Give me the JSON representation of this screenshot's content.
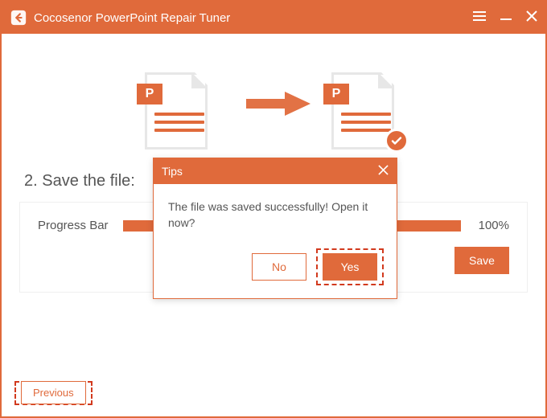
{
  "colors": {
    "accent": "#e06a3b",
    "highlight_dash": "#d23a1e",
    "text": "#555555"
  },
  "titlebar": {
    "app_title": "Cocosenor PowerPoint Repair Tuner"
  },
  "illustration": {
    "doc_tag": "P"
  },
  "step": {
    "label": "2. Save the file:"
  },
  "progress": {
    "label": "Progress Bar",
    "percent_text": "100%"
  },
  "panel": {
    "save_label": "Save"
  },
  "footer": {
    "previous_label": "Previous"
  },
  "modal": {
    "title": "Tips",
    "message": "The file was saved successfully! Open it now?",
    "no_label": "No",
    "yes_label": "Yes"
  }
}
